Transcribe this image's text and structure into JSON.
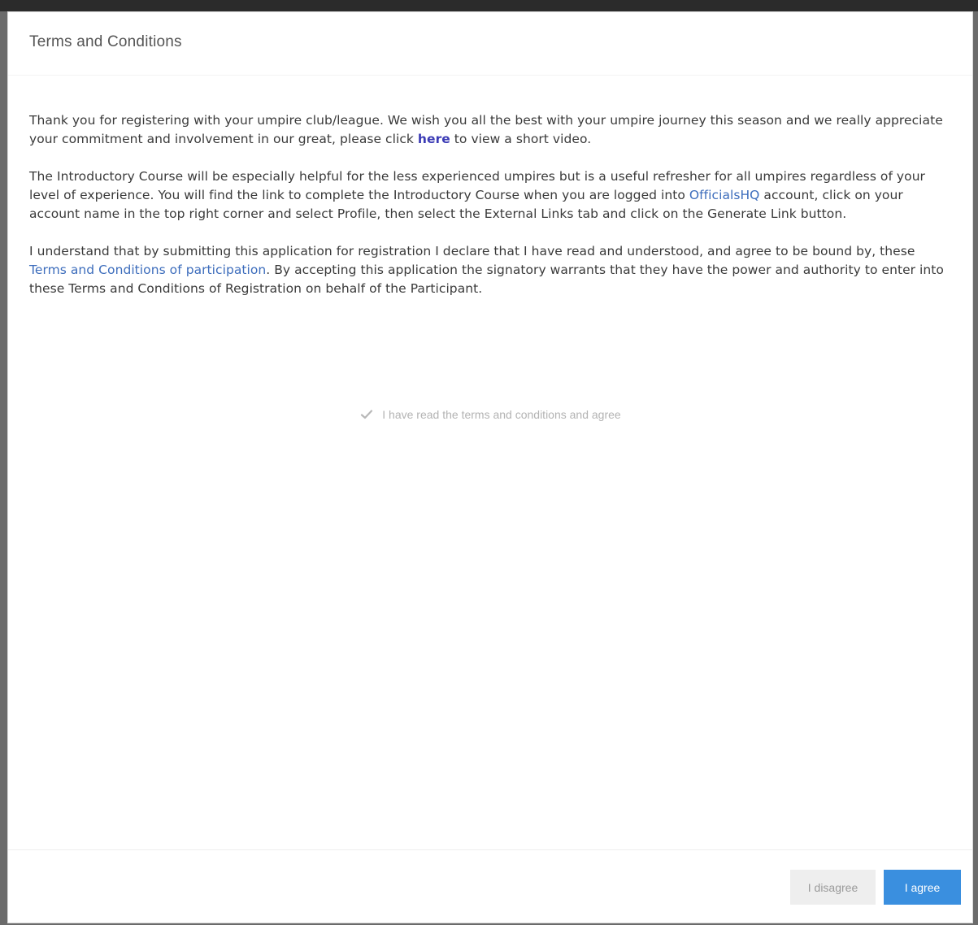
{
  "dialog": {
    "title": "Terms and Conditions"
  },
  "body": {
    "p1": {
      "before": "Thank you for registering with your umpire club/league. We wish you all the best with your umpire journey this season and we really appreciate your commitment and  involvement in our great, please click ",
      "link": "here",
      "after": " to view a short video."
    },
    "p2": {
      "before": "The Introductory Course will be especially helpful for the less experienced umpires but is a useful refresher for all umpires regardless of your level of experience. You will find the link to complete the Introductory Course when you are logged into ",
      "link": "OfficialsHQ",
      "after": " account, click on your account name in the top right corner and select Profile, then select the External Links tab and click on the Generate Link button."
    },
    "p3": {
      "before": "I understand that by submitting this application for registration I declare that I have read and understood, and agree to be bound by, these ",
      "link": "Terms and Conditions of participation",
      "after": ". By accepting this application the signatory warrants that they have the power and authority to enter into these Terms and Conditions of Registration on behalf of the Participant."
    },
    "agree_checkbox": {
      "label": "I have read the terms and conditions and agree",
      "checked": true
    }
  },
  "footer": {
    "disagree_label": "I disagree",
    "agree_label": "I agree"
  },
  "colors": {
    "agree_button": "#3a8fdf",
    "disagree_button": "#eeeeee",
    "link": "#3d6dbc",
    "link_bold": "#3b3bb5"
  }
}
